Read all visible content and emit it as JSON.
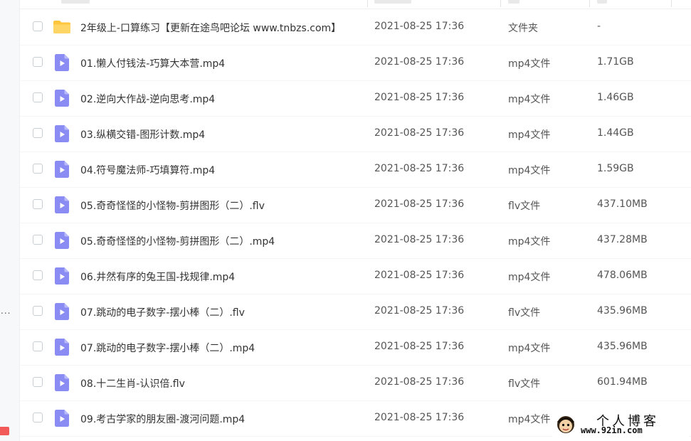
{
  "sidebar": {
    "overflow_dots": "..."
  },
  "colors": {
    "video_icon": "#8a8cf4",
    "folder_icon": "#ffc53d",
    "text_primary": "#333333",
    "text_secondary": "#555555"
  },
  "files": [
    {
      "name": "2年级上-口算练习【更新在途鸟吧论坛 www.tnbzs.com】",
      "date": "2021-08-25 17:36",
      "type": "文件夹",
      "size": "-",
      "icon": "folder-icon"
    },
    {
      "name": "01.懒人付钱法-巧算大本营.mp4",
      "date": "2021-08-25 17:36",
      "type": "mp4文件",
      "size": "1.71GB",
      "icon": "video-file-icon"
    },
    {
      "name": "02.逆向大作战-逆向思考.mp4",
      "date": "2021-08-25 17:36",
      "type": "mp4文件",
      "size": "1.46GB",
      "icon": "video-file-icon"
    },
    {
      "name": "03.纵横交错-图形计数.mp4",
      "date": "2021-08-25 17:36",
      "type": "mp4文件",
      "size": "1.44GB",
      "icon": "video-file-icon"
    },
    {
      "name": "04.符号魔法师-巧填算符.mp4",
      "date": "2021-08-25 17:36",
      "type": "mp4文件",
      "size": "1.59GB",
      "icon": "video-file-icon"
    },
    {
      "name": "05.奇奇怪怪的小怪物-剪拼图形（二）.flv",
      "date": "2021-08-25 17:36",
      "type": "flv文件",
      "size": "437.10MB",
      "icon": "video-file-icon"
    },
    {
      "name": "05.奇奇怪怪的小怪物-剪拼图形（二）.mp4",
      "date": "2021-08-25 17:36",
      "type": "mp4文件",
      "size": "437.28MB",
      "icon": "video-file-icon"
    },
    {
      "name": "06.井然有序的兔王国-找规律.mp4",
      "date": "2021-08-25 17:36",
      "type": "mp4文件",
      "size": "478.06MB",
      "icon": "video-file-icon"
    },
    {
      "name": "07.跳动的电子数字-摆小棒（二）.flv",
      "date": "2021-08-25 17:36",
      "type": "flv文件",
      "size": "435.96MB",
      "icon": "video-file-icon"
    },
    {
      "name": "07.跳动的电子数字-摆小棒（二）.mp4",
      "date": "2021-08-25 17:36",
      "type": "mp4文件",
      "size": "435.96MB",
      "icon": "video-file-icon"
    },
    {
      "name": "08.十二生肖-认识倍.flv",
      "date": "2021-08-25 17:36",
      "type": "flv文件",
      "size": "601.94MB",
      "icon": "video-file-icon"
    },
    {
      "name": "09.考古学家的朋友圈-渡河问题.mp4",
      "date": "2021-08-25 17:36",
      "type": "mp4文件",
      "size": "",
      "icon": "video-file-icon"
    }
  ],
  "watermark": {
    "title": "个人博客",
    "url": "www.92in.com"
  }
}
